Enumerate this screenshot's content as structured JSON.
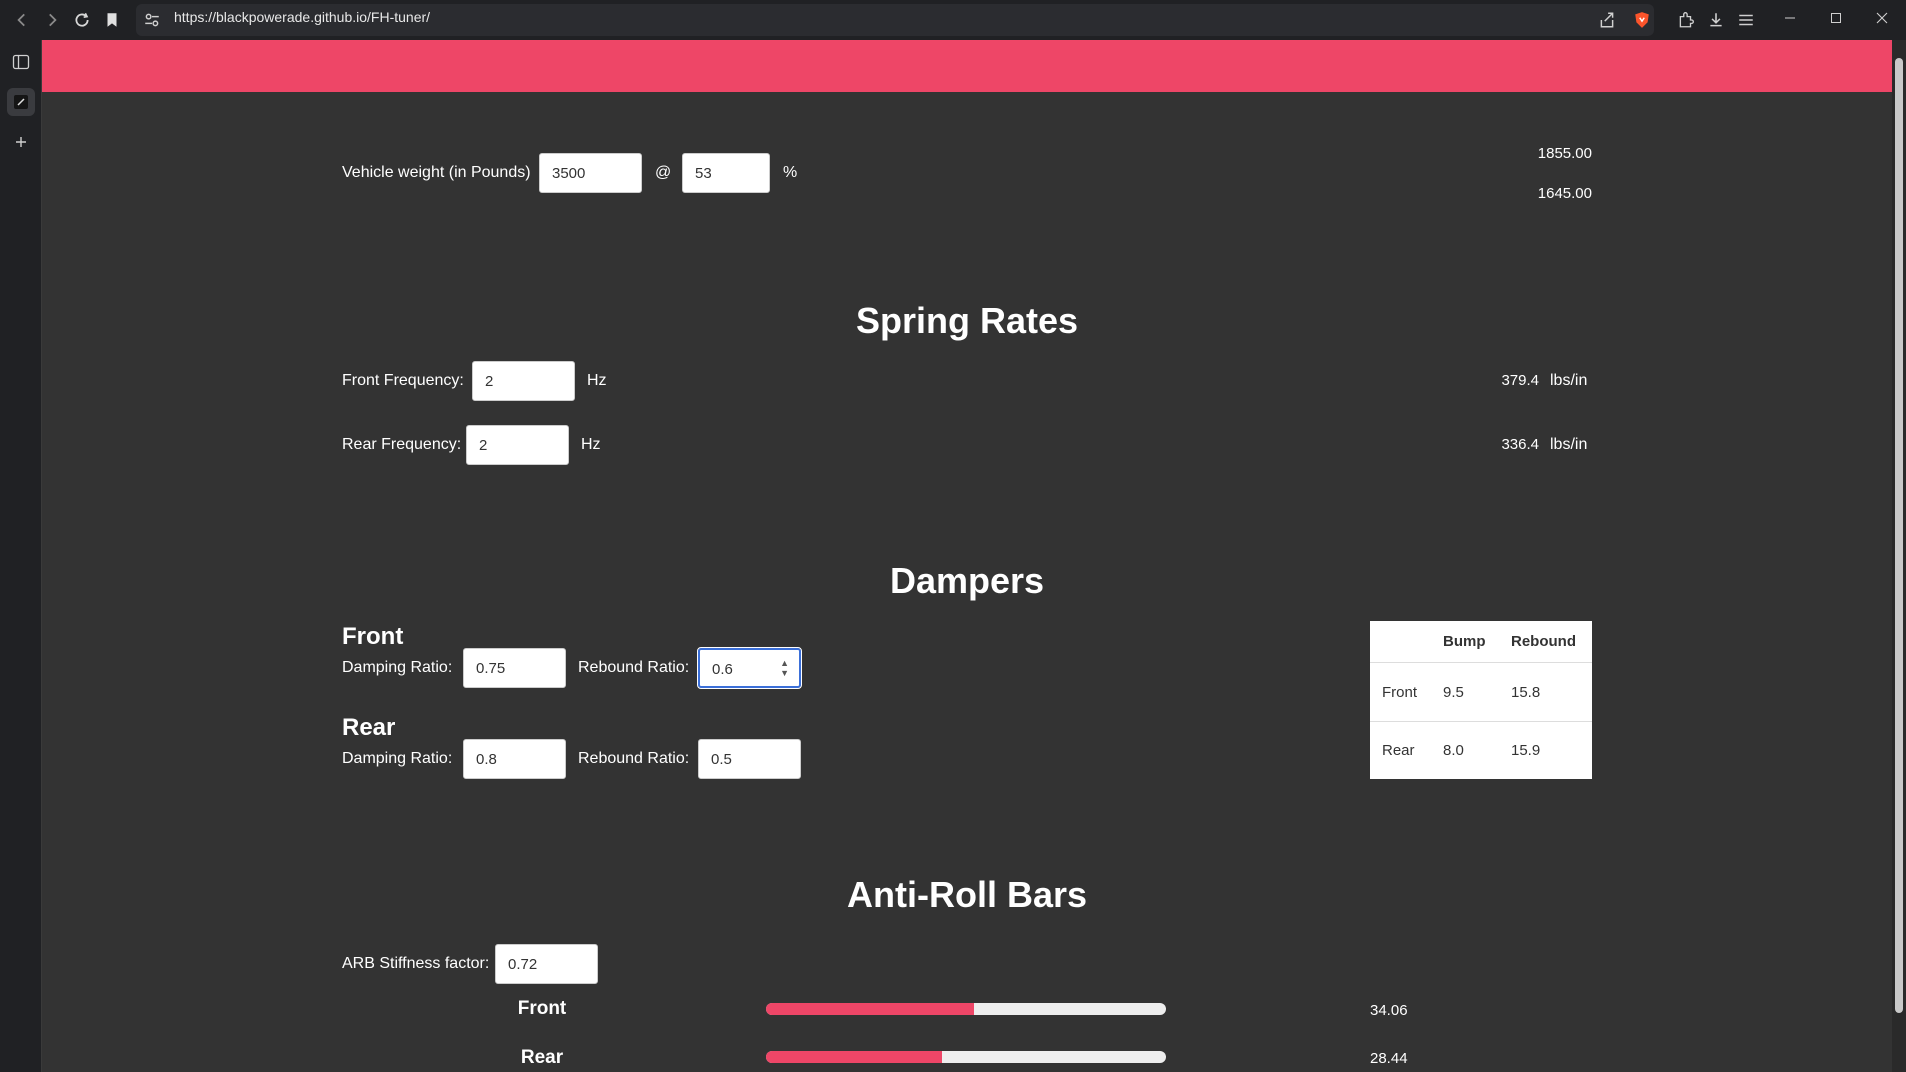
{
  "browser": {
    "url": "https://blackpowerade.github.io/FH-tuner/"
  },
  "weight": {
    "label": "Vehicle weight (in Pounds)",
    "value": "3500",
    "at": "@",
    "distribution": "53",
    "percent": "%",
    "front_weight": "1855.00",
    "rear_weight": "1645.00"
  },
  "springs": {
    "title": "Spring Rates",
    "front_label": "Front Frequency:",
    "front_value": "2",
    "rear_label": "Rear Frequency:",
    "rear_value": "2",
    "unit": "Hz",
    "front_rate": "379.4",
    "rear_rate": "336.4",
    "rate_unit": "lbs/in"
  },
  "dampers": {
    "title": "Dampers",
    "front_title": "Front",
    "rear_title": "Rear",
    "damping_label": "Damping Ratio:",
    "rebound_label": "Rebound Ratio:",
    "front_damping": "0.75",
    "front_rebound": "0.6",
    "rear_damping": "0.8",
    "rear_rebound": "0.5",
    "table": {
      "headers": [
        "",
        "Bump",
        "Rebound"
      ],
      "rows": [
        {
          "name": "Front",
          "bump": "9.5",
          "rebound": "15.8"
        },
        {
          "name": "Rear",
          "bump": "8.0",
          "rebound": "15.9"
        }
      ]
    }
  },
  "arb": {
    "title": "Anti-Roll Bars",
    "stiffness_label": "ARB Stiffness factor:",
    "stiffness_value": "0.72",
    "front_label": "Front",
    "rear_label": "Rear",
    "front_value": "34.06",
    "rear_value": "28.44",
    "front_fill": 0.52,
    "rear_fill": 0.44
  },
  "colors": {
    "accent": "#ee4667",
    "background": "#333333"
  }
}
